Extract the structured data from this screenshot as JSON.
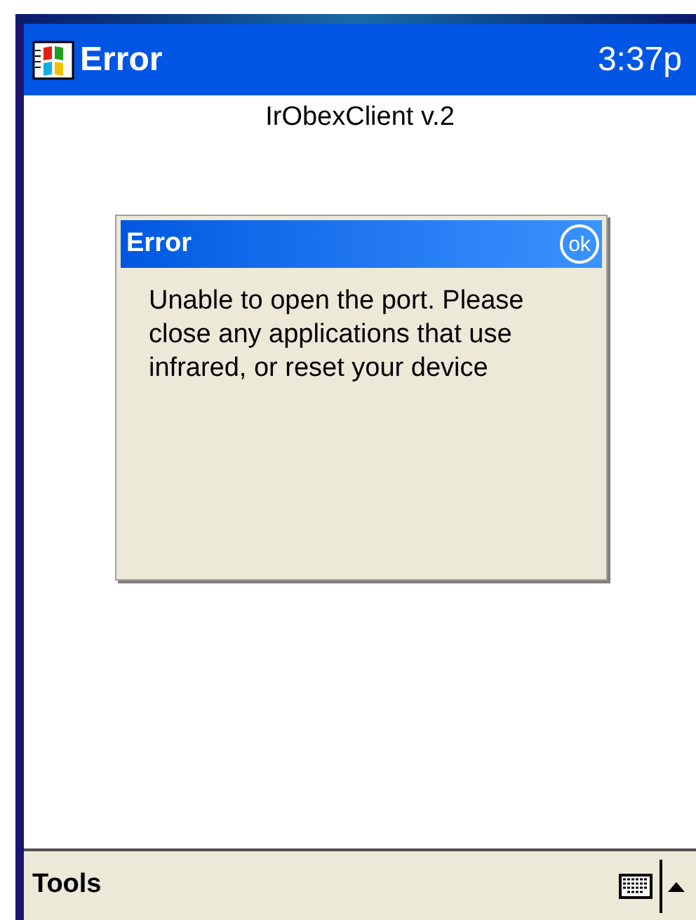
{
  "title_bar": {
    "title": "Error",
    "time": "3:37p"
  },
  "app_heading": "IrObexClient v.2",
  "dialog": {
    "title": "Error",
    "ok_button": "ok",
    "message": "Unable to open the port. Please close any applications that use infrared, or reset your device"
  },
  "menu_bar": {
    "items": [
      "Tools"
    ]
  }
}
